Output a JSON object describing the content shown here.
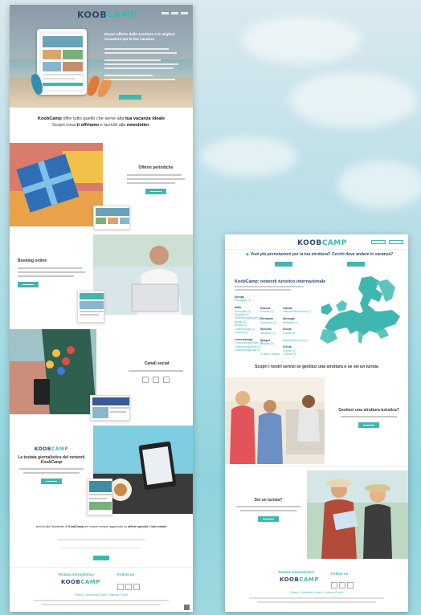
{
  "brand": {
    "logo_part1": "KOOB",
    "logo_part2": "CAMP",
    "accent": "#3fb7b0",
    "navy": "#2b4a6e"
  },
  "left": {
    "hero_title": "Ricevi offerte dalle strutture e le migliori occasioni per le tue vacanze",
    "intro_line1_pre": "KoobCamp",
    "intro_line1_mid": " offre tutto quello che serve alla ",
    "intro_line1_bold": "tua vacanza ideale",
    "intro_line2_pre": "Scopri cosa ",
    "intro_line2_bold1": "ti offriamo",
    "intro_line2_mid": " e iscriviti alla ",
    "intro_line2_bold2": "newsletter",
    "intro_line2_end": ".",
    "sections": {
      "offers": "Offerte periodiche",
      "booking": "Booking online",
      "social": "Canali social",
      "journal_line1": "La testata giornalistica del network",
      "journal_line2": "KoobCamp"
    },
    "newsletter_text1": "Iscriviti alla Newsletter di ",
    "newsletter_brand": "KoobCamp",
    "newsletter_text2": " per essere sempre aggiornato su ",
    "newsletter_bold": "offerte speciali",
    "newsletter_text3": " e ",
    "newsletter_bold2": "last minute",
    "footer_col1": "Testata Giornalistica",
    "footer_col2": "Follow us",
    "footer_links": "Privacy · Informativa Cookie · Gestione Cookie"
  },
  "right": {
    "q1": "Vuoi più prenotazioni per la tua struttura?",
    "q2": "Cerchi dove andare in vacanza?",
    "net_title": "KoobCamp: network turistico internazionale",
    "countries": {
      "col1": [
        "Europa",
        "Portogallo (1)",
        "",
        "Italia",
        "Portogallo (3)",
        "Bulgaria (1)",
        "Tenerife/Lanzarote (1)",
        "Belgio (1)",
        "Austria (1)",
        "Lussemburgo (1)",
        "Croazia (1)",
        "",
        "Lussemburgo",
        "Lussemburgo/Esteri (1)",
        "Lussemburgo/Dati (1)",
        "Lussemburgo/Alpi (1)"
      ],
      "col2": [
        "Francia",
        "Francia (1)",
        "",
        "Germania",
        "Germania (1)",
        "",
        "Slovenia",
        "Slovenia (1)",
        "",
        "Spagna",
        "Spagna (2)",
        "",
        "",
        "In tutto il mondo"
      ],
      "col3": [
        "Olanda",
        "Olanda/Paesi Bassi (1)",
        "",
        "Norvegia",
        "Norvegia (1)",
        "",
        "Svezia",
        "Svezia (1)",
        "",
        "Repubblica Ceca (1)",
        "",
        "Grecia",
        "Grecia (1)",
        "Turchia (1)"
      ]
    },
    "tagline": "Scopri i nostri servizi se gestisci una struttura o se sei un turista",
    "q_manager": "Gestisci una struttura turistica?",
    "q_tourist": "Sei un turista?",
    "footer_col1": "Testata Giornalistica",
    "footer_col2": "Follow us",
    "footer_links": "Privacy · Informativa Cookie · Gestione Cookie"
  }
}
